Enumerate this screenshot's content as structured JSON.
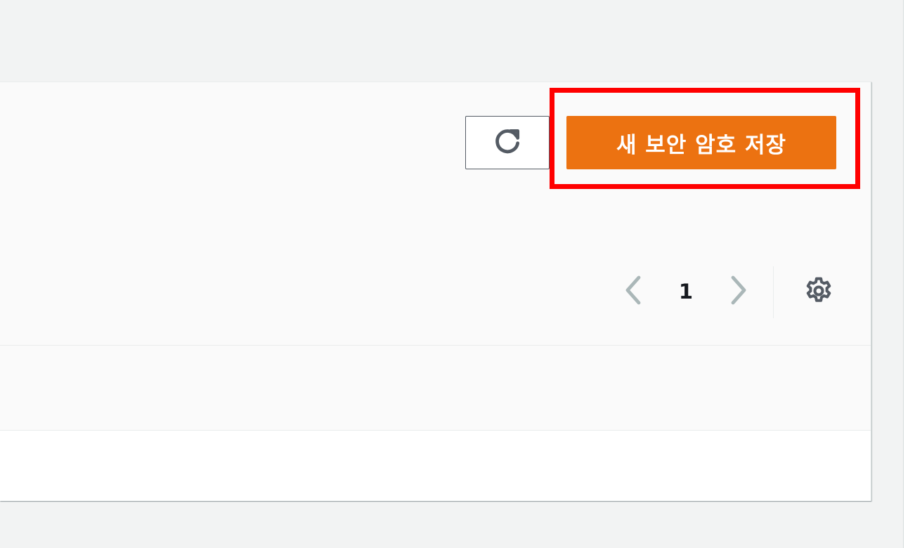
{
  "toolbar": {
    "refresh_icon": "refresh-icon",
    "primary_label": "새 보안 암호 저장",
    "primary_color": "#ec7211"
  },
  "pagination": {
    "current_page": "1",
    "prev_icon": "chevron-left-icon",
    "next_icon": "chevron-right-icon"
  },
  "preferences": {
    "icon": "gear-icon"
  },
  "highlight": {
    "color": "#ff0000"
  }
}
